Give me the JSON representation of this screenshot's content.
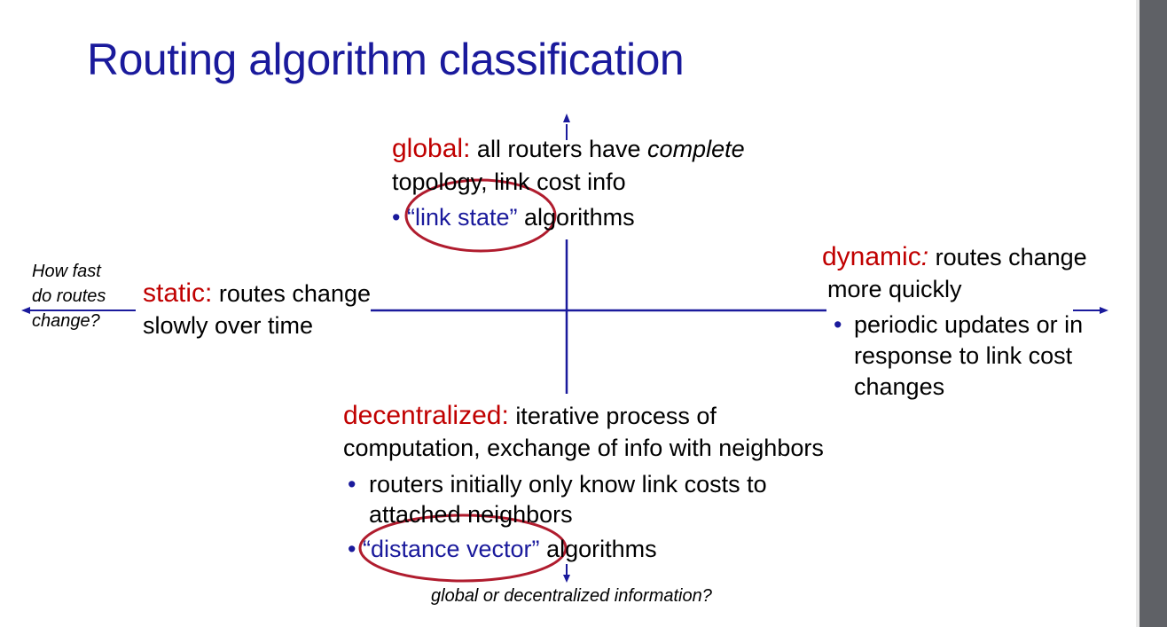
{
  "title": "Routing algorithm classification",
  "global": {
    "keyword": "global:",
    "line1": "all routers have",
    "line1_em": "complete",
    "line2": "topology, link cost info",
    "bullet": "•",
    "bullet_highlight": "“link state”",
    "bullet_rest": "algorithms"
  },
  "static": {
    "keyword": "static:",
    "line1": "routes change",
    "line2": "slowly over time"
  },
  "dynamic": {
    "keyword": "dynamic",
    "colon": ":",
    "line1": "routes change",
    "line2": "more quickly",
    "bullet": "•",
    "bullet_lines": [
      "periodic updates or in",
      "response to link cost",
      "changes"
    ]
  },
  "decentralized": {
    "keyword": "decentralized:",
    "line1": "iterative process of",
    "line2": "computation, exchange of info with neighbors",
    "bullet": "•",
    "bullet1_lines": [
      "routers initially only know link costs to",
      "attached neighbors"
    ],
    "bullet2_highlight": "“distance vector”",
    "bullet2_rest": "algorithms"
  },
  "axis_labels": {
    "horizontal": [
      "How fast",
      "do routes",
      "change?"
    ],
    "vertical": "global or decentralized information?"
  },
  "colors": {
    "title": "#1a1a9c",
    "keyword": "#c00000",
    "axis": "#1a1a9c",
    "ellipse": "#b01c2e"
  }
}
